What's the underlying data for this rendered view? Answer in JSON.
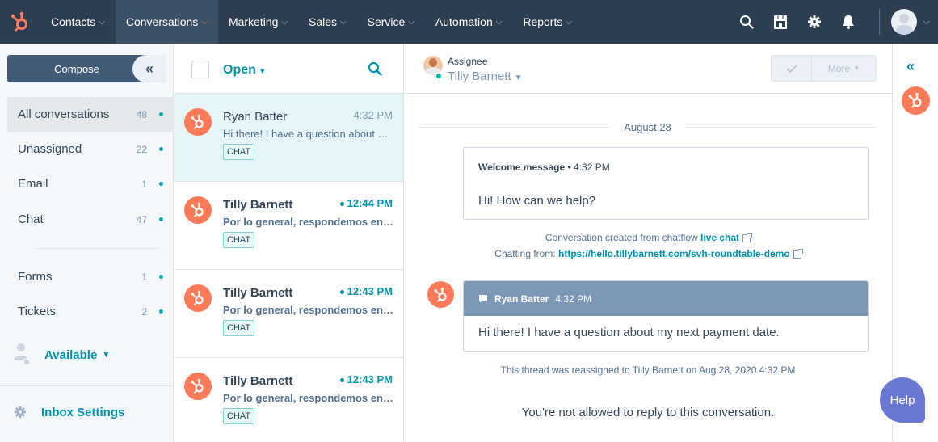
{
  "topnav": {
    "items": [
      {
        "label": "Contacts"
      },
      {
        "label": "Conversations"
      },
      {
        "label": "Marketing"
      },
      {
        "label": "Sales"
      },
      {
        "label": "Service"
      },
      {
        "label": "Automation"
      },
      {
        "label": "Reports"
      }
    ],
    "active_index": 1,
    "icons": [
      "search-icon",
      "marketplace-icon",
      "settings-gear-icon",
      "notifications-bell-icon",
      "user-avatar"
    ]
  },
  "sidebar": {
    "compose_label": "Compose",
    "items": [
      {
        "label": "All conversations",
        "count": "48"
      },
      {
        "label": "Unassigned",
        "count": "22"
      },
      {
        "label": "Email",
        "count": "1"
      },
      {
        "label": "Chat",
        "count": "47"
      },
      {
        "label": "Forms",
        "count": "1"
      },
      {
        "label": "Tickets",
        "count": "2"
      }
    ],
    "availability": "Available",
    "inbox_settings": "Inbox Settings"
  },
  "list": {
    "filter_label": "Open",
    "conversations": [
      {
        "name": "Ryan Batter",
        "time": "4:32 PM",
        "preview": "Hi there! I have a question about my next payment date.",
        "tag": "CHAT"
      },
      {
        "name": "Tilly Barnett",
        "time": "12:44 PM",
        "preview": "Por lo general, respondemos en unos minutos",
        "tag": "CHAT"
      },
      {
        "name": "Tilly Barnett",
        "time": "12:43 PM",
        "preview": "Por lo general, respondemos en unos minutos",
        "tag": "CHAT"
      },
      {
        "name": "Tilly Barnett",
        "time": "12:43 PM",
        "preview": "Por lo general, respondemos en unos minutos",
        "tag": "CHAT"
      }
    ]
  },
  "thread": {
    "assignee_label": "Assignee",
    "assignee_name": "Tilly Barnett",
    "more_label": "More",
    "date_label": "August 28",
    "welcome": {
      "title": "Welcome message",
      "time": "4:32 PM",
      "body": "Hi! How can we help?"
    },
    "created_prefix": "Conversation created from chatflow",
    "created_link": "live chat",
    "chatting_prefix": "Chatting from:",
    "chatting_link": "https://hello.tillybarnett.com/svh-roundtable-demo",
    "message": {
      "sender": "Ryan Batter",
      "time": "4:32 PM",
      "body": "Hi there! I have a question about my next payment date."
    },
    "reassigned": "This thread was reassigned to Tilly Barnett on Aug 28, 2020 4:32 PM",
    "no_reply": "You're not allowed to reply to this conversation."
  },
  "help_label": "Help",
  "colors": {
    "nav_bg": "#2d3e50",
    "accent_orange": "#ff7a59",
    "link_teal": "#0091ae",
    "help_purple": "#6a78d1"
  }
}
